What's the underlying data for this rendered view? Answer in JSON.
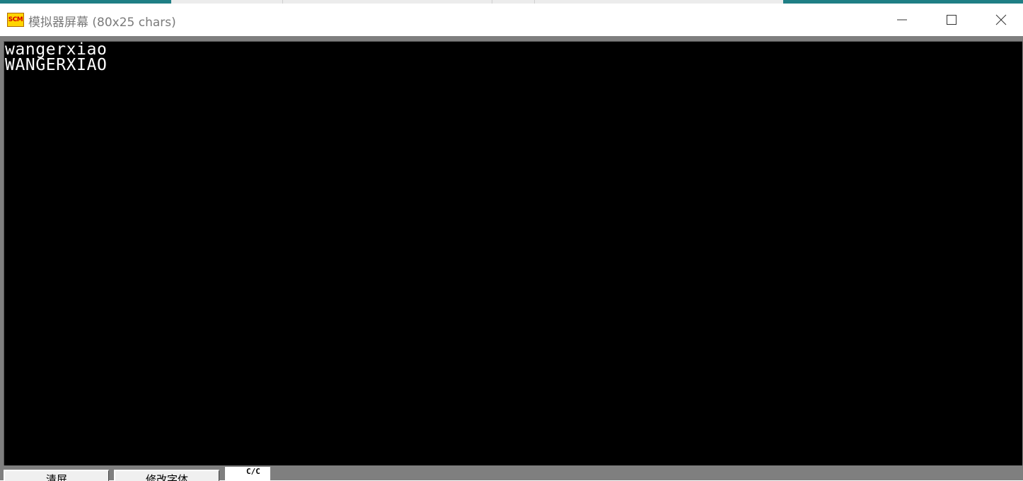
{
  "window": {
    "title": "模拟器屏幕 (80x25 chars)",
    "icon_text": "SCM",
    "icon_name": "scm-app-icon"
  },
  "window_controls": {
    "minimize_icon": "minimize-icon",
    "maximize_icon": "maximize-icon",
    "close_icon": "close-icon"
  },
  "screen": {
    "lines": [
      "wangerxiao",
      "WANGERXIAO"
    ],
    "background": "#000000",
    "foreground": "#ffffff"
  },
  "toolbar": {
    "clear_label": "清屏",
    "font_label": "修改字体",
    "widget_text": "C/C"
  },
  "colors": {
    "taskbar_accent": "#1f7f85",
    "frame": "#7f7f7f",
    "title_text": "#7a7a7a"
  }
}
